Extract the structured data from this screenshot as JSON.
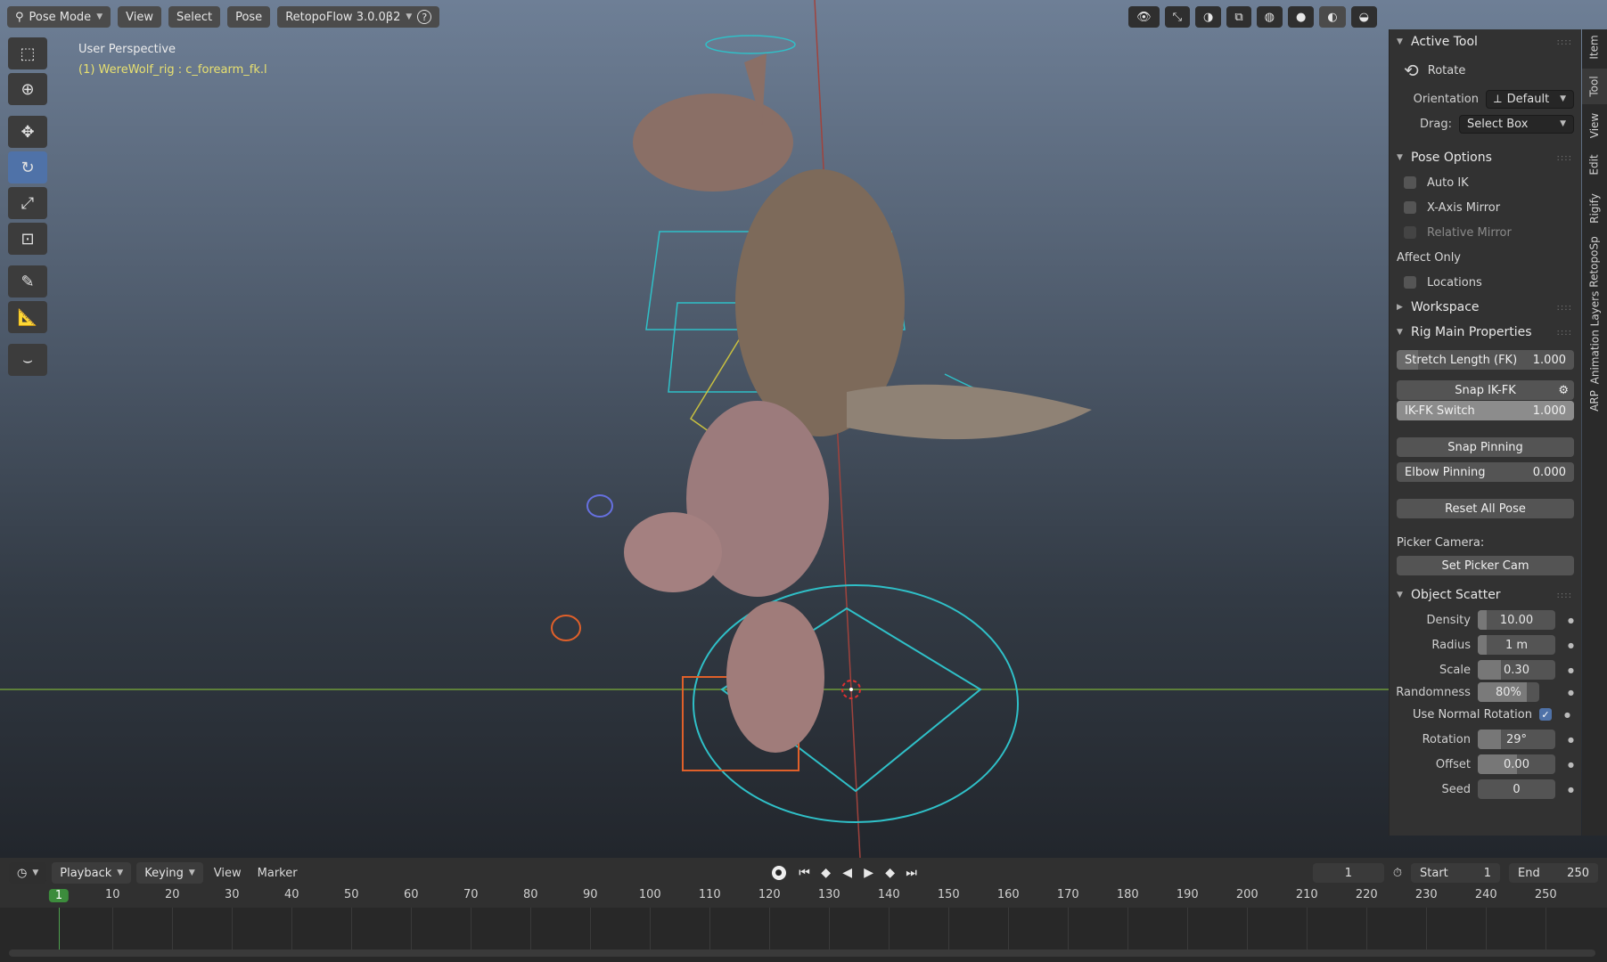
{
  "header": {
    "mode": "Pose Mode",
    "menus": [
      "View",
      "Select",
      "Pose"
    ],
    "addon": "RetopoFlow 3.0.0β2",
    "help_glyph": "?"
  },
  "viewport": {
    "perspective": "User Perspective",
    "object_info": "(1) WereWolf_rig : c_forearm_fk.l"
  },
  "toolbar": {
    "tools": [
      {
        "name": "select-box-icon",
        "glyph": "⬚"
      },
      {
        "name": "cursor-icon",
        "glyph": "⊕"
      },
      {
        "name": "move-icon",
        "glyph": "✥"
      },
      {
        "name": "rotate-icon",
        "glyph": "↻"
      },
      {
        "name": "scale-icon",
        "glyph": "⤢"
      },
      {
        "name": "transform-icon",
        "glyph": "⊡"
      },
      {
        "name": "annotate-icon",
        "glyph": "✎"
      },
      {
        "name": "measure-icon",
        "glyph": "📐"
      },
      {
        "name": "curve-icon",
        "glyph": "⌣"
      }
    ],
    "active_index": 3
  },
  "panel": {
    "active_tool": {
      "header": "Active Tool",
      "tool_name": "Rotate",
      "orientation_label": "Orientation",
      "orientation_value": "Default",
      "drag_label": "Drag:",
      "drag_value": "Select Box"
    },
    "pose_options": {
      "header": "Pose Options",
      "auto_ik": "Auto IK",
      "x_axis_mirror": "X-Axis Mirror",
      "relative_mirror": "Relative Mirror",
      "affect_only": "Affect Only",
      "locations": "Locations"
    },
    "workspace": {
      "header": "Workspace"
    },
    "rig_main": {
      "header": "Rig Main Properties",
      "stretch_label": "Stretch Length (FK)",
      "stretch_value": "1.000",
      "snap_ikfk": "Snap IK-FK",
      "ikfk_label": "IK-FK Switch",
      "ikfk_value": "1.000",
      "snap_pinning": "Snap Pinning",
      "elbow_label": "Elbow Pinning",
      "elbow_value": "0.000",
      "reset_pose": "Reset All Pose",
      "picker_camera": "Picker Camera:",
      "set_picker": "Set Picker Cam"
    },
    "object_scatter": {
      "header": "Object Scatter",
      "fields": [
        {
          "label": "Density",
          "value": "10.00",
          "fill": 0.12
        },
        {
          "label": "Radius",
          "value": "1 m",
          "fill": 0.12
        },
        {
          "label": "Scale",
          "value": "0.30",
          "fill": 0.3
        }
      ],
      "randomness_label": "Randomness",
      "randomness_value": "80%",
      "randomness_fill": 0.8,
      "normal_rotation": "Use Normal Rotation",
      "fields2": [
        {
          "label": "Rotation",
          "value": "29°",
          "fill": 0.3
        },
        {
          "label": "Offset",
          "value": "0.00",
          "fill": 0.5
        },
        {
          "label": "Seed",
          "value": "0",
          "fill": 0
        }
      ]
    }
  },
  "side_tabs": [
    "Item",
    "Tool",
    "View",
    "Edit",
    "Rigify",
    "RetopoSp",
    "Animation Layers",
    "ARP"
  ],
  "timeline": {
    "menus": [
      "Playback",
      "Keying",
      "View",
      "Marker"
    ],
    "current_frame": "1",
    "start_label": "Start",
    "start_value": "1",
    "end_label": "End",
    "end_value": "250",
    "ticks": [
      "10",
      "20",
      "30",
      "40",
      "50",
      "60",
      "70",
      "80",
      "90",
      "100",
      "110",
      "120",
      "130",
      "140",
      "150",
      "160",
      "170",
      "180",
      "190",
      "200",
      "210",
      "220",
      "230",
      "240",
      "250"
    ],
    "cursor_label": "1"
  }
}
